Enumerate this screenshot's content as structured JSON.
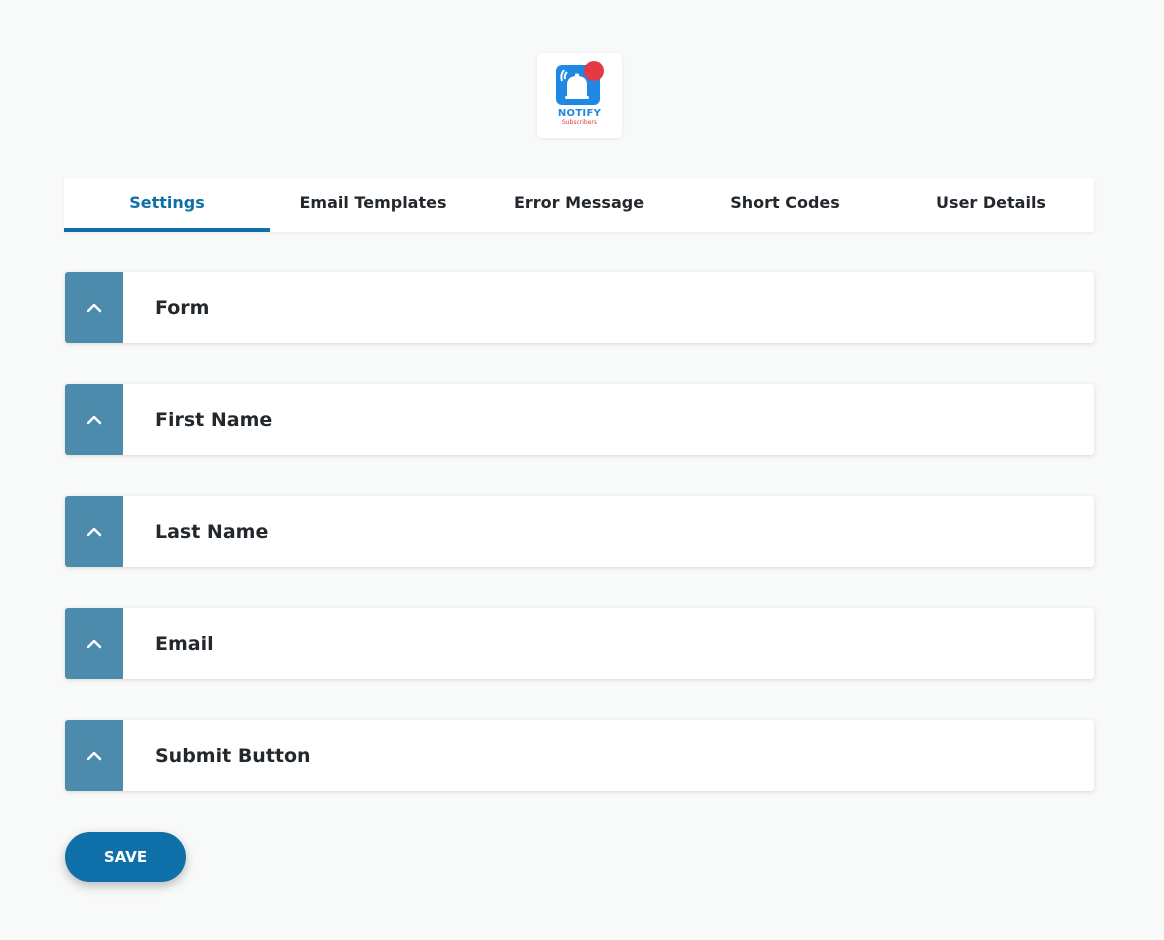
{
  "logo": {
    "line1": "NOTIFY",
    "line2": "Subscribers",
    "colors": {
      "blue": "#1e88e5",
      "red": "#e53945"
    }
  },
  "tabs": [
    {
      "label": "Settings",
      "active": true
    },
    {
      "label": "Email Templates",
      "active": false
    },
    {
      "label": "Error Message",
      "active": false
    },
    {
      "label": "Short Codes",
      "active": false
    },
    {
      "label": "User Details",
      "active": false
    }
  ],
  "panels": [
    {
      "title": "Form",
      "icon": "chevron-up-icon"
    },
    {
      "title": "First Name",
      "icon": "chevron-up-icon"
    },
    {
      "title": "Last Name",
      "icon": "chevron-up-icon"
    },
    {
      "title": "Email",
      "icon": "chevron-up-icon"
    },
    {
      "title": "Submit Button",
      "icon": "chevron-up-icon"
    }
  ],
  "save_label": "SAVE",
  "colors": {
    "accent": "#0f6fa8",
    "panel_toggle": "#4c8bab",
    "background": "#f8f9f9"
  }
}
